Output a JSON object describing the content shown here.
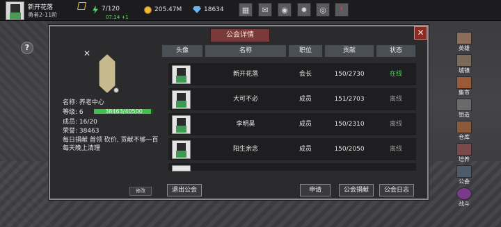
{
  "player": {
    "name": "新开花落",
    "rank": "勇者2-11阶",
    "energy": "7/120",
    "energy_timer": "07:14 +1",
    "gold": "205.47M",
    "gems": "18634"
  },
  "hud_buttons": [
    {
      "name": "shop-icon",
      "glyph": "▦"
    },
    {
      "name": "mail-icon",
      "glyph": "✉"
    },
    {
      "name": "gamepad-icon",
      "glyph": "◉"
    },
    {
      "name": "settings-gear-icon",
      "glyph": "✹"
    },
    {
      "name": "color-wheel-icon",
      "glyph": "◎"
    },
    {
      "name": "alert-icon",
      "glyph": "!"
    }
  ],
  "help_label": "?",
  "panel": {
    "title": "公会详情",
    "close_label": "✕"
  },
  "guild": {
    "x_mark": "✕",
    "name_label": "名称: 养老中心",
    "level_label": "等级: 6",
    "xp_text": "38463/40500",
    "xp_progress": 0.95,
    "members_label": "成员: 16/20",
    "honor_label": "荣誉: 38463",
    "notice": "每日捐献 首领 砍价, 贡献不够一百每天晚上清理",
    "edit_label": "修改"
  },
  "table": {
    "headers": [
      "头像",
      "名称",
      "职位",
      "贡献",
      "状态"
    ],
    "rows": [
      {
        "name": "新开花落",
        "role": "会长",
        "contribution": "150/2730",
        "status": "在线",
        "online": true
      },
      {
        "name": "大可不必",
        "role": "成员",
        "contribution": "151/2703",
        "status": "离线",
        "online": false
      },
      {
        "name": "李明昊",
        "role": "成员",
        "contribution": "150/2310",
        "status": "离线",
        "online": false
      },
      {
        "name": "阳生余念",
        "role": "成员",
        "contribution": "150/2050",
        "status": "离线",
        "online": false
      }
    ]
  },
  "buttons": {
    "leave": "退出公会",
    "apply": "申请",
    "donate": "公会捐献",
    "log": "公会日志"
  },
  "sidebar": {
    "items": [
      "英雄",
      "城镇",
      "集市",
      "钼造",
      "仓库",
      "培养",
      "公会",
      "战斗"
    ]
  }
}
